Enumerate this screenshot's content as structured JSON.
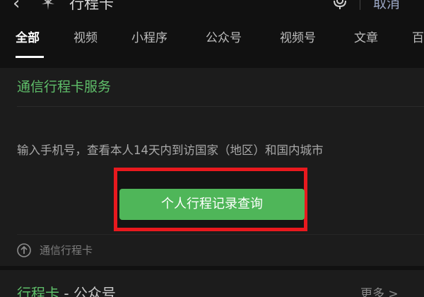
{
  "header": {
    "back_icon": "chevron-left-icon",
    "app_icon": "sparkle-icon",
    "query": "行程卡",
    "mic_icon": "microphone-icon",
    "cancel_label": "取消"
  },
  "tabs": [
    {
      "label": "全部",
      "active": true
    },
    {
      "label": "视频",
      "active": false
    },
    {
      "label": "小程序",
      "active": false
    },
    {
      "label": "公众号",
      "active": false
    },
    {
      "label": "视频号",
      "active": false
    },
    {
      "label": "文章",
      "active": false
    },
    {
      "label": "百",
      "active": false
    }
  ],
  "card": {
    "title": "通信行程卡服务",
    "description": "输入手机号，查看本人14天内到访国家（地区）和国内城市",
    "button_label": "个人行程记录查询",
    "source_icon": "arrow-up-circle-icon",
    "source_name": "通信行程卡"
  },
  "next_section": {
    "title": "行程卡",
    "separator": " - ",
    "subtitle": "公众号",
    "more_label": "更多 >"
  },
  "colors": {
    "accent_green": "#5fbf6a",
    "button_green": "#4fb659",
    "highlight_red": "#e8191e",
    "background": "#111111",
    "card_background": "#1c1c1c"
  }
}
